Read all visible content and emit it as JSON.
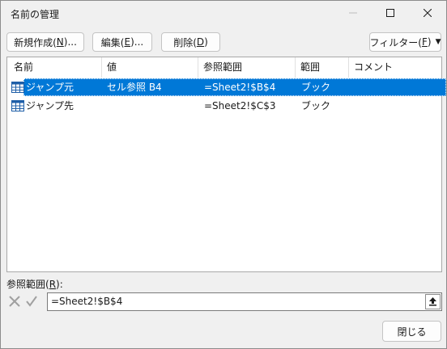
{
  "window": {
    "title": "名前の管理"
  },
  "toolbar": {
    "new_label_pre": "新規作成(",
    "new_key": "N",
    "new_label_post": ")...",
    "edit_label_pre": "編集(",
    "edit_key": "E",
    "edit_label_post": ")...",
    "delete_label_pre": "削除(",
    "delete_key": "D",
    "delete_label_post": ")",
    "filter_label_pre": "フィルター(",
    "filter_key": "F",
    "filter_label_post": ")"
  },
  "list": {
    "columns": [
      "名前",
      "値",
      "参照範囲",
      "範囲",
      "コメント"
    ],
    "rows": [
      {
        "name": "ジャンプ元",
        "value": "セル参照 B4",
        "ref": "=Sheet2!$B$4",
        "scope": "ブック",
        "comment": "",
        "selected": true
      },
      {
        "name": "ジャンプ先",
        "value": "",
        "ref": "=Sheet2!$C$3",
        "scope": "ブック",
        "comment": "",
        "selected": false
      }
    ]
  },
  "refers_to": {
    "label_pre": "参照範囲(",
    "label_key": "R",
    "label_post": "):",
    "value": "=Sheet2!$B$4"
  },
  "footer": {
    "close_label": "閉じる"
  },
  "colors": {
    "selection": "#0078d7",
    "background": "#f0f0f0"
  },
  "icons": [
    "minimize-icon",
    "maximize-icon",
    "close-icon",
    "name-table-icon",
    "cancel-x-icon",
    "confirm-check-icon",
    "collapse-dialog-icon",
    "dropdown-arrow-icon"
  ]
}
